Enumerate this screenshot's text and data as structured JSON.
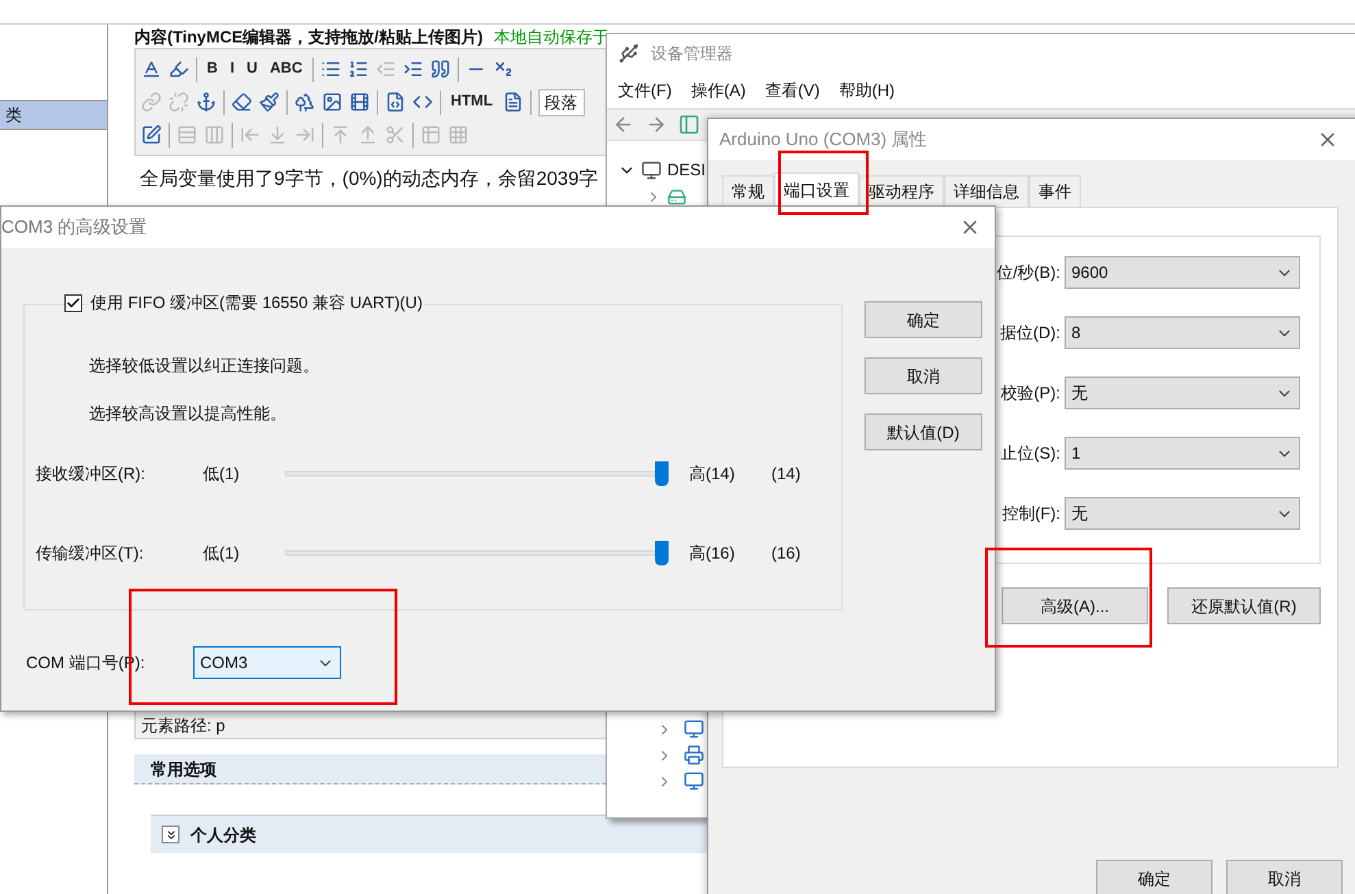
{
  "page": {
    "sidebar_items": [
      {
        "label": "类",
        "selected": true
      }
    ],
    "editor": {
      "label": "内容(TinyMCE编辑器，支持拖放/粘贴上传图片)",
      "autosave": "本地自动保存于",
      "toolbar": [
        [
          {
            "kind": "icon",
            "disabled": false
          },
          {
            "kind": "icon",
            "disabled": false
          },
          {
            "kind": "sep"
          },
          {
            "kind": "text",
            "label": "B",
            "disabled": false
          },
          {
            "kind": "text",
            "label": "I",
            "disabled": false
          },
          {
            "kind": "text",
            "label": "U",
            "disabled": false
          },
          {
            "kind": "text",
            "label": "ABC",
            "disabled": false
          },
          {
            "kind": "sep"
          },
          {
            "kind": "icon",
            "disabled": false
          },
          {
            "kind": "icon",
            "disabled": false
          },
          {
            "kind": "icon",
            "disabled": true
          },
          {
            "kind": "icon",
            "disabled": false
          },
          {
            "kind": "icon",
            "disabled": false
          },
          {
            "kind": "sep"
          },
          {
            "kind": "icon",
            "disabled": false
          },
          {
            "kind": "icon",
            "disabled": false
          }
        ],
        [
          {
            "kind": "icon",
            "disabled": true
          },
          {
            "kind": "icon",
            "disabled": true
          },
          {
            "kind": "icon",
            "disabled": false
          },
          {
            "kind": "sep"
          },
          {
            "kind": "icon",
            "disabled": false
          },
          {
            "kind": "icon",
            "disabled": false
          },
          {
            "kind": "sep"
          },
          {
            "kind": "icon",
            "disabled": false
          },
          {
            "kind": "icon",
            "disabled": false
          },
          {
            "kind": "icon",
            "disabled": false
          },
          {
            "kind": "sep"
          },
          {
            "kind": "icon",
            "disabled": false
          },
          {
            "kind": "icon",
            "disabled": false
          },
          {
            "kind": "sep"
          },
          {
            "kind": "text",
            "label": "HTML",
            "disabled": false
          },
          {
            "kind": "icon",
            "disabled": false
          },
          {
            "kind": "sep"
          },
          {
            "kind": "dropdown",
            "label": "段落"
          }
        ],
        [
          {
            "kind": "icon",
            "disabled": false
          },
          {
            "kind": "sep"
          },
          {
            "kind": "icon",
            "disabled": true
          },
          {
            "kind": "icon",
            "disabled": true
          },
          {
            "kind": "sep"
          },
          {
            "kind": "icon",
            "disabled": true
          },
          {
            "kind": "icon",
            "disabled": true
          },
          {
            "kind": "icon",
            "disabled": true
          },
          {
            "kind": "sep"
          },
          {
            "kind": "icon",
            "disabled": true
          },
          {
            "kind": "icon",
            "disabled": true
          },
          {
            "kind": "icon",
            "disabled": true
          },
          {
            "kind": "sep"
          },
          {
            "kind": "icon",
            "disabled": true
          },
          {
            "kind": "icon",
            "disabled": true
          }
        ]
      ],
      "content": "全局变量使用了9字节，(0%)的动态内存，余留2039字",
      "element_path": "元素路径: p"
    },
    "sections": [
      {
        "kind": "header",
        "title": "常用选项"
      },
      {
        "kind": "collapsible",
        "title": "个人分类",
        "expanded": false
      }
    ]
  },
  "device_manager": {
    "title": "设备管理器",
    "menu": [
      "文件(F)",
      "操作(A)",
      "查看(V)",
      "帮助(H)"
    ],
    "tree": [
      {
        "label": "DESI",
        "expanded": true
      }
    ]
  },
  "properties": {
    "title": "Arduino Uno (COM3) 属性",
    "tabs": [
      {
        "label": "常规",
        "selected": false
      },
      {
        "label": "端口设置",
        "selected": true
      },
      {
        "label": "驱动程序",
        "selected": false
      },
      {
        "label": "详细信息",
        "selected": false
      },
      {
        "label": "事件",
        "selected": false
      }
    ],
    "fields": [
      {
        "label": "位/秒(B):",
        "value": "9600"
      },
      {
        "label": "据位(D):",
        "value": "8"
      },
      {
        "label": "校验(P):",
        "value": "无"
      },
      {
        "label": "止位(S):",
        "value": "1"
      },
      {
        "label": "控制(F):",
        "value": "无"
      }
    ],
    "buttons": [
      "高级(A)...",
      "还原默认值(R)"
    ],
    "footer_buttons": [
      "确定",
      "取消"
    ]
  },
  "advanced": {
    "title": "COM3 的高级设置",
    "fifo": {
      "label": "使用 FIFO 缓冲区(需要 16550 兼容 UART)(U)",
      "checked": true
    },
    "hints": [
      "选择较低设置以纠正连接问题。",
      "选择较高设置以提高性能。"
    ],
    "sliders": [
      {
        "label": "接收缓冲区(R):",
        "low": "低(1)",
        "high": "高(14)",
        "reading": "(14)",
        "level": 1
      },
      {
        "label": "传输缓冲区(T):",
        "low": "低(1)",
        "high": "高(16)",
        "reading": "(16)",
        "level": 1
      }
    ],
    "buttons": [
      "确定",
      "取消",
      "默认值(D)"
    ],
    "port": {
      "label": "COM 端口号(P):",
      "value": "COM3"
    }
  }
}
